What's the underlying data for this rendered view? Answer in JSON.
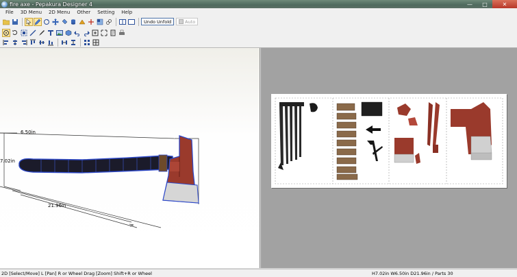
{
  "window": {
    "title": "fire axe - Pepakura Designer 4",
    "minimize": "—",
    "maximize": "□",
    "close": "✕"
  },
  "menu": [
    "File",
    "3D Menu",
    "2D Menu",
    "Other",
    "Setting",
    "Help"
  ],
  "toolbar": {
    "undo_unfold": "Undo Unfold",
    "auto": "Auto"
  },
  "viewport3d": {
    "dim_depth": "6.50in",
    "dim_height": "7.02in",
    "dim_width": "21.96in"
  },
  "status": {
    "left": "2D [Select/Move] L [Pan] R or Wheel Drag [Zoom] Shift+R or Wheel",
    "right": "H7.02in W6.50in D21.96in / Parts 30"
  },
  "colors": {
    "accent": "#4c72a8",
    "axe_head": "#9a3a2c",
    "handle": "#2a3c8a"
  }
}
